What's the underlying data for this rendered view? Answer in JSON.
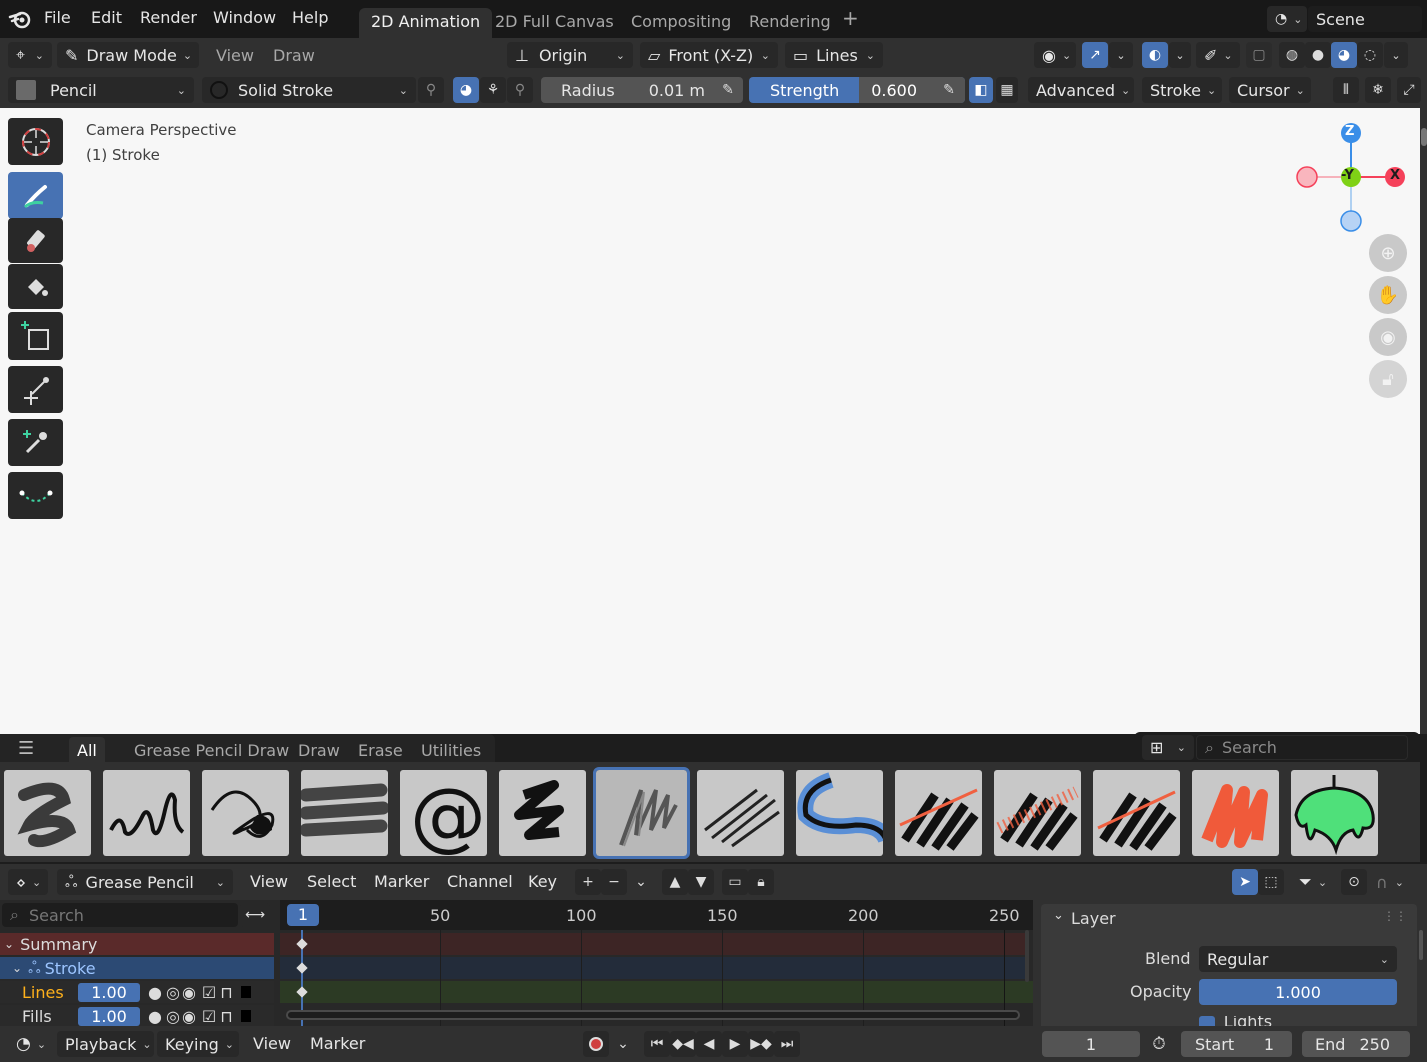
{
  "topbar": {
    "menus": [
      "File",
      "Edit",
      "Render",
      "Window",
      "Help"
    ],
    "workspace_tabs": [
      "2D Animation",
      "2D Full Canvas",
      "Compositing",
      "Rendering"
    ],
    "active_tab": "2D Animation",
    "scene": "Scene"
  },
  "header1": {
    "mode": "Draw Mode",
    "view": "View",
    "draw": "Draw",
    "origin": "Origin",
    "front": "Front (X-Z)",
    "lines": "Lines"
  },
  "header2": {
    "brush": "Pencil",
    "material": "Solid Stroke",
    "radius_label": "Radius",
    "radius_value": "0.01 m",
    "strength_label": "Strength",
    "strength_value": "0.600",
    "advanced": "Advanced",
    "stroke": "Stroke",
    "cursor": "Cursor"
  },
  "viewport": {
    "perspective": "Camera Perspective",
    "object": "(1) Stroke",
    "gizmo": {
      "z": "Z",
      "y": "-Y",
      "x": "X"
    }
  },
  "asset_shelf": {
    "tabs": [
      "All",
      "Grease Pencil Draw",
      "Draw",
      "Erase",
      "Utilities"
    ],
    "active_tab": "All",
    "search_placeholder": "Search",
    "selected_index": 6
  },
  "dopesheet": {
    "mode": "Grease Pencil",
    "menus": [
      "View",
      "Select",
      "Marker",
      "Channel",
      "Key"
    ],
    "search_placeholder": "Search",
    "current_frame": "1",
    "ruler": [
      "50",
      "100",
      "150",
      "200",
      "250"
    ],
    "channels": {
      "summary": "Summary",
      "object": "Stroke",
      "layers": [
        {
          "name": "Lines",
          "value": "1.00"
        },
        {
          "name": "Fills",
          "value": "1.00"
        }
      ]
    },
    "layer_panel": {
      "title": "Layer",
      "blend_label": "Blend",
      "blend_value": "Regular",
      "opacity_label": "Opacity",
      "opacity_value": "1.000",
      "lights_label": "Lights"
    }
  },
  "timeline": {
    "playback": "Playback",
    "keying": "Keying",
    "view": "View",
    "marker": "Marker",
    "frame": "1",
    "start_label": "Start",
    "start_value": "1",
    "end_label": "End",
    "end_value": "250"
  },
  "colors": {
    "accent": "#4772b3",
    "gizmo_x": "#f5415a",
    "gizmo_y": "#7fd116",
    "gizmo_z": "#3a8ee8"
  }
}
